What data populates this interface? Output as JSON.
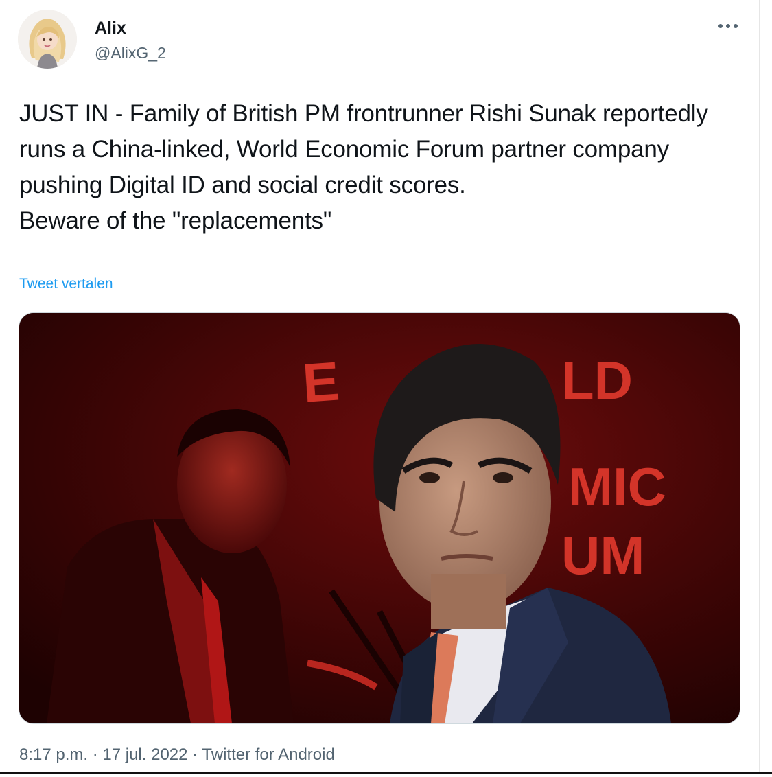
{
  "tweet": {
    "author": {
      "display_name": "Alix",
      "handle": "@AlixG_2",
      "avatar_icon": "avatar-cartoon-blonde-woman"
    },
    "more_icon": "more-horizontal-icon",
    "text": "JUST IN - Family of British PM frontrunner Rishi Sunak reportedly runs a China-linked, World Economic Forum partner company pushing Digital ID and social credit scores.\nBeware of the \"replacements\"",
    "translate_label": "Tweet vertalen",
    "meta": {
      "time": "8:17 p.m.",
      "separator": " · ",
      "date": "17 jul. 2022",
      "source": "Twitter for Android"
    }
  },
  "colors": {
    "link": "#1d9bf0",
    "secondary_text": "#536471",
    "media_red": "#c81e1e"
  }
}
